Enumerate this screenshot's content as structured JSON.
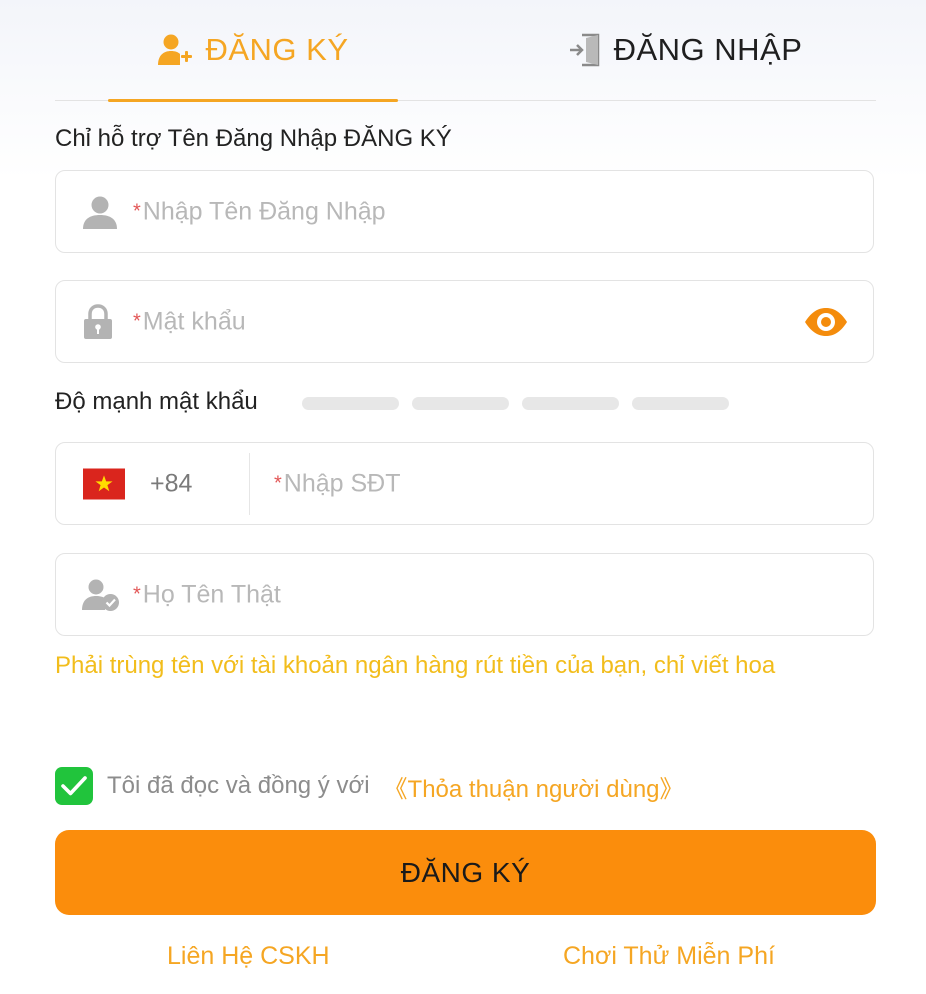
{
  "tabs": {
    "register_label": "ĐĂNG KÝ",
    "login_label": "ĐĂNG NHẬP"
  },
  "hint": "Chỉ hỗ trợ Tên Đăng Nhập ĐĂNG KÝ",
  "required_mark": "*",
  "fields": {
    "username_placeholder": "Nhập Tên Đăng Nhập",
    "password_placeholder": "Mật khẩu",
    "phone_code": "+84",
    "phone_placeholder": "Nhập SĐT",
    "realname_placeholder": "Họ Tên Thật"
  },
  "strength": {
    "label": "Độ mạnh mật khẩu",
    "segments": 4,
    "level": 0
  },
  "realname_note": "Phải trùng tên với tài khoản ngân hàng rút tiền của bạn, chỉ viết hoa",
  "agree": {
    "checked": true,
    "text": "Tôi đã đọc và đồng ý với",
    "link": "《Thỏa thuận người dùng》"
  },
  "submit_label": "ĐĂNG KÝ",
  "links": {
    "support": "Liên Hệ CSKH",
    "trial": "Chơi Thử Miễn Phí"
  },
  "icons": {
    "register_tab": "user-plus-icon",
    "login_tab": "login-door-icon",
    "username": "user-icon",
    "password": "lock-icon",
    "visibility": "eye-icon",
    "flag": "vietnam-flag-icon",
    "realname": "user-check-icon",
    "checkbox": "checkmark-icon"
  },
  "colors": {
    "accent": "#f5a623",
    "button": "#fb8d0c",
    "note": "#f2bd1c",
    "checkbox": "#21c43c",
    "required": "#e25555"
  }
}
